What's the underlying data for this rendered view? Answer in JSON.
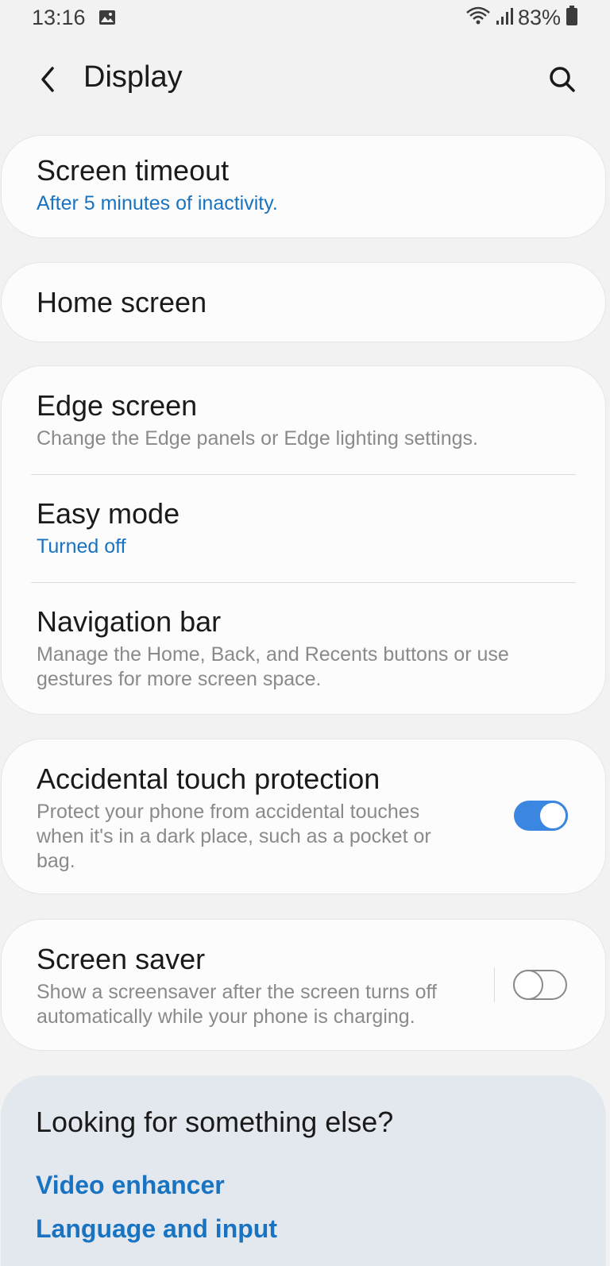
{
  "status_bar": {
    "time": "13:16",
    "battery": "83%"
  },
  "header": {
    "title": "Display"
  },
  "settings": {
    "screen_timeout": {
      "title": "Screen timeout",
      "subtitle": "After 5 minutes of inactivity."
    },
    "home_screen": {
      "title": "Home screen"
    },
    "edge_screen": {
      "title": "Edge screen",
      "subtitle": "Change the Edge panels or Edge lighting settings."
    },
    "easy_mode": {
      "title": "Easy mode",
      "subtitle": "Turned off"
    },
    "navigation_bar": {
      "title": "Navigation bar",
      "subtitle": "Manage the Home, Back, and Recents buttons or use gestures for more screen space."
    },
    "accidental_touch": {
      "title": "Accidental touch protection",
      "subtitle": "Protect your phone from accidental touches when it's in a dark place, such as a pocket or bag.",
      "enabled": true
    },
    "screen_saver": {
      "title": "Screen saver",
      "subtitle": "Show a screensaver after the screen turns off automatically while your phone is charging.",
      "enabled": false
    }
  },
  "suggestions": {
    "title": "Looking for something else?",
    "links": [
      "Video enhancer",
      "Language and input"
    ]
  },
  "colors": {
    "accent": "#1a73c1",
    "toggle_on": "#3a86e0",
    "background": "#f2f2f2",
    "card": "#fcfcfc",
    "suggest_bg": "#e3e8ef"
  }
}
